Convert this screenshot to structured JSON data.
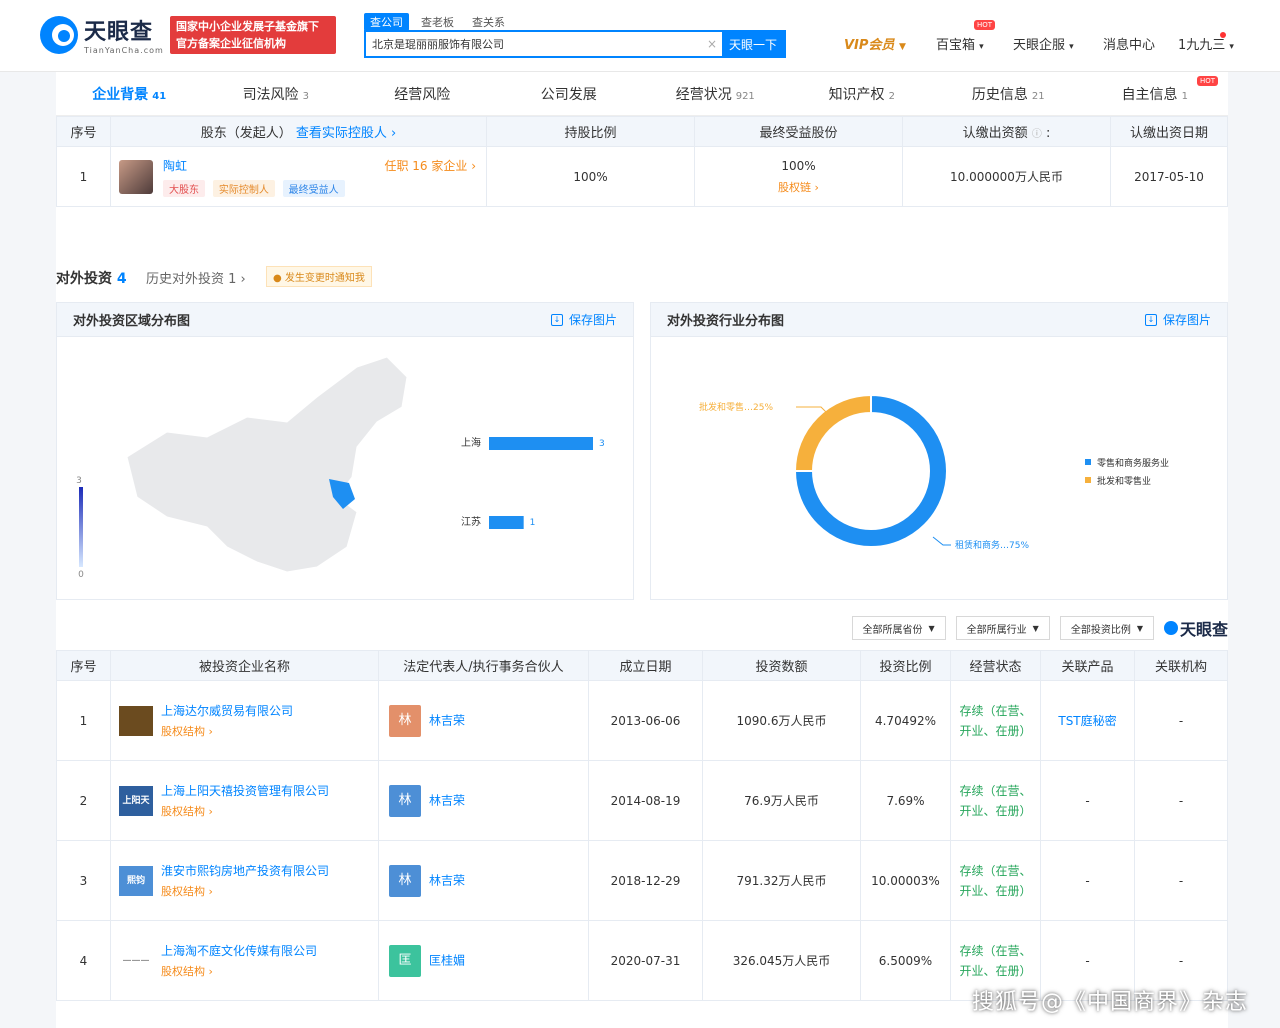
{
  "header": {
    "logo_cn": "天眼查",
    "logo_en": "TianYanCha.com",
    "promo_line1": "国家中小企业发展子基金旗下",
    "promo_line2": "官方备案企业征信机构",
    "search_tabs": [
      "查公司",
      "查老板",
      "查关系"
    ],
    "search_value": "北京是琨丽丽服饰有限公司",
    "search_button": "天眼一下",
    "nav": {
      "vip": "VIP会员",
      "baibao": "百宝箱",
      "enterprise": "天眼企服",
      "messages": "消息中心",
      "user": "1九九三"
    },
    "hot": "HOT"
  },
  "company_tabs": [
    {
      "label": "企业背景",
      "count": "41"
    },
    {
      "label": "司法风险",
      "count": "3"
    },
    {
      "label": "经营风险",
      "count": ""
    },
    {
      "label": "公司发展",
      "count": ""
    },
    {
      "label": "经营状况",
      "count": "921"
    },
    {
      "label": "知识产权",
      "count": "2"
    },
    {
      "label": "历史信息",
      "count": "21"
    },
    {
      "label": "自主信息",
      "count": "1"
    }
  ],
  "shareholders": {
    "headers": {
      "idx": "序号",
      "name": "股东（发起人）",
      "actual": "查看实际控股人",
      "ratio": "持股比例",
      "benefit": "最终受益股份",
      "capital": "认缴出资额",
      "date": "认缴出资日期"
    },
    "row": {
      "idx": "1",
      "name": "陶虹",
      "tags": [
        "大股东",
        "实际控制人",
        "最终受益人"
      ],
      "positions": "任职 16 家企业",
      "ratio": "100%",
      "benefit": "100%",
      "benefit_link": "股权链",
      "capital": "10.000000万人民币",
      "date": "2017-05-10"
    }
  },
  "invest": {
    "title": "对外投资",
    "count": "4",
    "history": "历史对外投资 1",
    "notify": "发生变更时通知我",
    "region_title": "对外投资区域分布图",
    "industry_title": "对外投资行业分布图",
    "save": "保存图片",
    "legend": [
      "零售和商务服务业",
      "批发和零售业"
    ],
    "scale": {
      "max": "3",
      "min": "0"
    },
    "labels": {
      "wholesale": "批发和零售…25%",
      "leasing": "租赁和商务…75%"
    }
  },
  "filters": [
    "全部所属省份",
    "全部所属行业",
    "全部投资比例"
  ],
  "brand": "天眼查",
  "investments": {
    "headers": [
      "序号",
      "被投资企业名称",
      "法定代表人/执行事务合伙人",
      "成立日期",
      "投资数额",
      "投资比例",
      "经营状态",
      "关联产品",
      "关联机构"
    ],
    "equity_label": "股权结构",
    "rows": [
      {
        "idx": "1",
        "logo": "",
        "logo_color": "#6b4b1f",
        "name": "上海达尔威贸易有限公司",
        "avatar": "林",
        "avatar_color": "#e3906a",
        "person": "林吉荣",
        "date": "2013-06-06",
        "amount": "1090.6万人民币",
        "ratio": "4.70492%",
        "status": "存续（在营、开业、在册）",
        "product": "TST庭秘密",
        "org": "-"
      },
      {
        "idx": "2",
        "logo": "上阳天禧",
        "logo_color": "#2e5f9e",
        "name": "上海上阳天禧投资管理有限公司",
        "avatar": "林",
        "avatar_color": "#4d8fd6",
        "person": "林吉荣",
        "date": "2014-08-19",
        "amount": "76.9万人民币",
        "ratio": "7.69%",
        "status": "存续（在营、开业、在册）",
        "product": "-",
        "org": "-"
      },
      {
        "idx": "3",
        "logo": "熙钧",
        "logo_color": "#4d8fd6",
        "name": "淮安市熙钧房地产投资有限公司",
        "avatar": "林",
        "avatar_color": "#4d8fd6",
        "person": "林吉荣",
        "date": "2018-12-29",
        "amount": "791.32万人民币",
        "ratio": "10.00003%",
        "status": "存续（在营、开业、在册）",
        "product": "-",
        "org": "-"
      },
      {
        "idx": "4",
        "logo": "———",
        "logo_color": "#ffffff",
        "name": "上海淘不庭文化传媒有限公司",
        "avatar": "匡",
        "avatar_color": "#3cc39d",
        "person": "匡桂媚",
        "date": "2020-07-31",
        "amount": "326.045万人民币",
        "ratio": "6.5009%",
        "status": "存续（在营、开业、在册）",
        "product": "-",
        "org": "-"
      }
    ]
  },
  "chart_data": [
    {
      "type": "bar",
      "title": "对外投资区域分布图",
      "categories": [
        "上海",
        "江苏"
      ],
      "values": [
        3,
        1
      ],
      "xlim": [
        0,
        3
      ]
    },
    {
      "type": "pie",
      "title": "对外投资行业分布图",
      "categories": [
        "批发和零售…",
        "租赁和商务…"
      ],
      "values": [
        25,
        75
      ],
      "colors": [
        "#f6b03c",
        "#1e8ff2"
      ]
    }
  ],
  "watermark": "搜狐号@《中国商界》杂志"
}
